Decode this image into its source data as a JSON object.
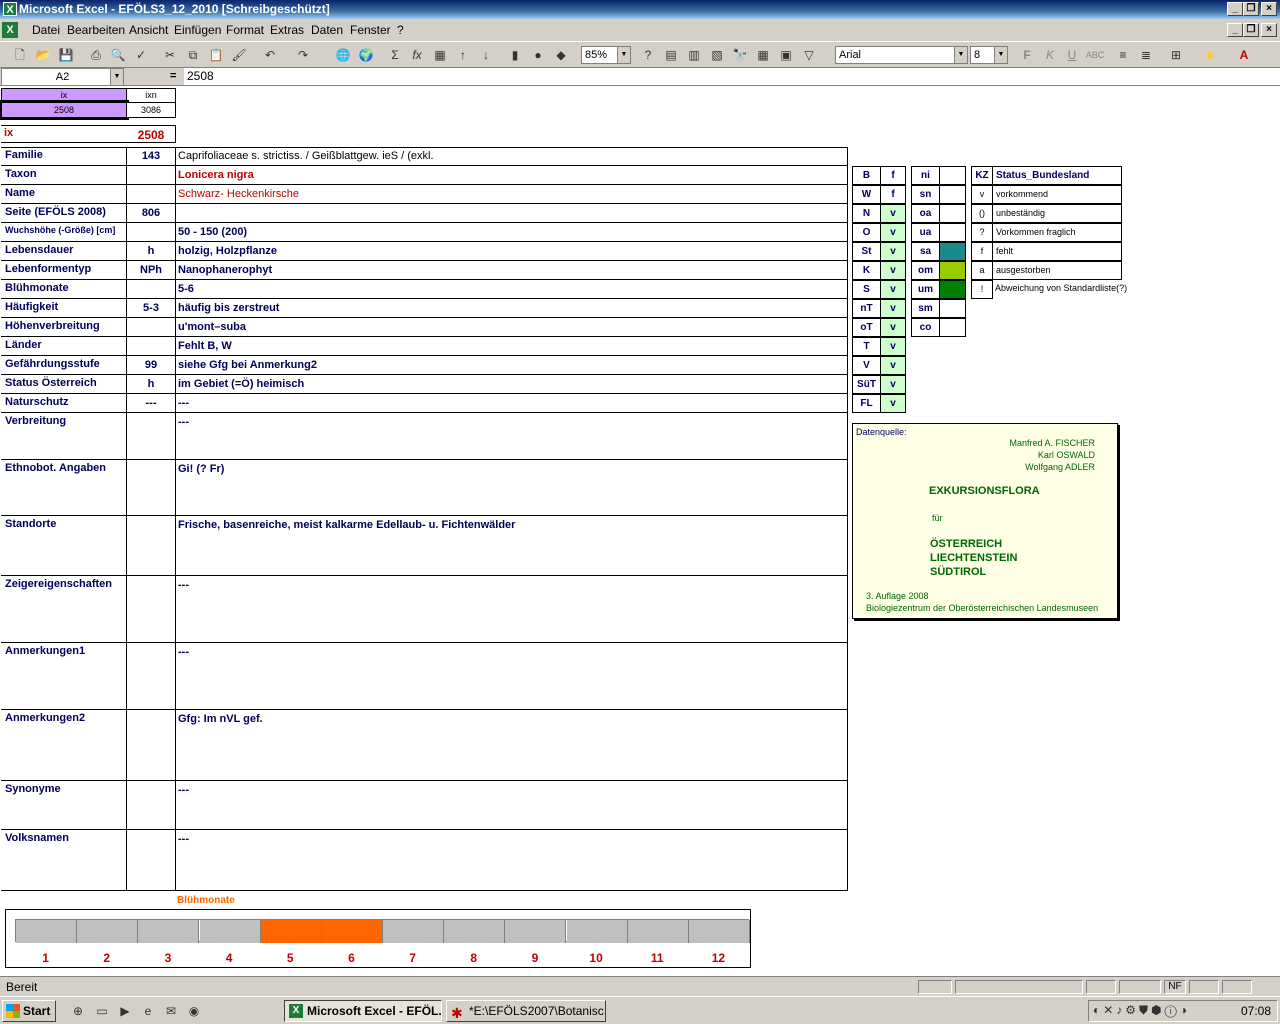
{
  "window": {
    "title": "Microsoft Excel - EFÖLS3_12_2010  [Schreibgeschützt]"
  },
  "menu": [
    "Datei",
    "Bearbeiten",
    "Ansicht",
    "Einfügen",
    "Format",
    "Extras",
    "Daten",
    "Fenster",
    "?"
  ],
  "toolbar": {
    "zoom": "85%",
    "font": "Arial",
    "size": "8"
  },
  "formula": {
    "name_box": "A2",
    "equals": "=",
    "value": "2508"
  },
  "topcells": {
    "ix_label": "ix",
    "ixn_label": "ixn",
    "ix_value": "2508",
    "ixn_value": "3086"
  },
  "ixrow": {
    "label": "ix",
    "value": "2508"
  },
  "rows": [
    {
      "label": "Familie",
      "code": "143",
      "value": "Caprifoliaceae s. strictiss.  /  Geißblattgew. ieS / (exkl."
    },
    {
      "label": "Taxon",
      "code": "",
      "value": "Lonicera nigra"
    },
    {
      "label": "Name",
      "code": "",
      "value": "Schwarz- Heckenkirsche"
    },
    {
      "label": "Seite (EFÖLS 2008)",
      "code": "806",
      "value": ""
    },
    {
      "label": "Wuchshöhe (-Größe) [cm]",
      "code": "",
      "value": " 50 - 150 (200)"
    },
    {
      "label": "Lebensdauer",
      "code": "h",
      "value": "holzig, Holzpflanze"
    },
    {
      "label": "Lebenformentyp",
      "code": "NPh",
      "value": "Nanophanerophyt"
    },
    {
      "label": "Blühmonate",
      "code": "",
      "value": " 5-6"
    },
    {
      "label": "Häufigkeit",
      "code": "5-3",
      "value": "häufig bis zerstreut"
    },
    {
      "label": "Höhenverbreitung",
      "code": "",
      "value": "u'mont–suba"
    },
    {
      "label": "Länder",
      "code": "",
      "value": "Fehlt B, W"
    },
    {
      "label": "Gefährdungsstufe",
      "code": "99",
      "value": "siehe Gfg bei Anmerkung2"
    },
    {
      "label": "Status Österreich",
      "code": "h",
      "value": "im Gebiet (=Ö) heimisch"
    },
    {
      "label": "Naturschutz",
      "code": "---",
      "value": " ---"
    }
  ],
  "tallrows": [
    {
      "label": "Verbreitung",
      "value": " ---"
    },
    {
      "label": "Ethnobot. Angaben",
      "value": " Gi! (? Fr)"
    },
    {
      "label": "Standorte",
      "value": "Frische, basenreiche, meist kalkarme Edellaub- u. Fichtenwälder"
    },
    {
      "label": "Zeigereigenschaften",
      "value": "---"
    },
    {
      "label": "Anmerkungen1",
      "value": "---"
    },
    {
      "label": "Anmerkungen2",
      "value": "Gfg: Im nVL gef."
    },
    {
      "label": "Synonyme",
      "value": "---"
    },
    {
      "label": "Volksnamen",
      "value": "---"
    }
  ],
  "states": [
    {
      "code": "B",
      "val": "f"
    },
    {
      "code": "W",
      "val": "f"
    },
    {
      "code": "N",
      "val": "v"
    },
    {
      "code": "O",
      "val": "v"
    },
    {
      "code": "St",
      "val": "v"
    },
    {
      "code": "K",
      "val": "v"
    },
    {
      "code": "S",
      "val": "v"
    },
    {
      "code": "nT",
      "val": "v"
    },
    {
      "code": "oT",
      "val": "v"
    },
    {
      "code": "T",
      "val": "v"
    },
    {
      "code": "V",
      "val": "v"
    },
    {
      "code": "SüT",
      "val": "v"
    },
    {
      "code": "FL",
      "val": "v"
    }
  ],
  "zones": [
    {
      "code": "ni",
      "color": ""
    },
    {
      "code": "sn",
      "color": ""
    },
    {
      "code": "oa",
      "color": ""
    },
    {
      "code": "ua",
      "color": ""
    },
    {
      "code": "sa",
      "color": "#1a8a8a"
    },
    {
      "code": "om",
      "color": "#99cc00"
    },
    {
      "code": "um",
      "color": "#008000"
    },
    {
      "code": "sm",
      "color": ""
    },
    {
      "code": "co",
      "color": ""
    }
  ],
  "legend": {
    "header_kz": "KZ",
    "header_status": "Status_Bundesland",
    "items": [
      {
        "kz": "v",
        "text": "vorkommend"
      },
      {
        "kz": "()",
        "text": "unbeständig"
      },
      {
        "kz": "?",
        "text": "Vorkommen fraglich"
      },
      {
        "kz": "f",
        "text": "fehlt"
      },
      {
        "kz": "a",
        "text": "ausgestorben"
      },
      {
        "kz": "!",
        "text": "Abweichung von Standardliste(?)"
      }
    ]
  },
  "source": {
    "label": "Datenquelle:",
    "authors": [
      "Manfred A. FISCHER",
      "Karl OSWALD",
      "Wolfgang ADLER"
    ],
    "title": "EXKURSIONSFLORA",
    "fuer": "für",
    "countries": [
      "ÖSTERREICH",
      "LIECHTENSTEIN",
      "SÜDTIROL"
    ],
    "edition": "3. Auflage 2008",
    "publisher": "Biologiezentrum der Oberösterreichischen Landesmuseen"
  },
  "bloom": {
    "title": "Blühmonate",
    "months": [
      "1",
      "2",
      "3",
      "4",
      "5",
      "6",
      "7",
      "8",
      "9",
      "10",
      "11",
      "12"
    ],
    "active": [
      5,
      6
    ],
    "active_color": "#ff6600"
  },
  "statusbar": {
    "text": "Bereit",
    "nf": "NF"
  },
  "taskbar": {
    "start": "Start",
    "task1": "Microsoft Excel - EFÖL...",
    "task2": "*E:\\EFÖLS2007\\Botanisc...",
    "clock": "07:08"
  }
}
